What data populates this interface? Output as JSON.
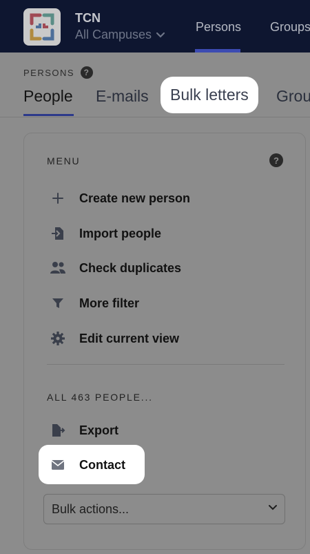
{
  "header": {
    "org": "TCN",
    "campus": "All Campuses",
    "nav": [
      "Persons",
      "Groups"
    ]
  },
  "subheader": {
    "section": "PERSONS",
    "tabs": [
      "People",
      "E-mails",
      "Bulk letters",
      "Grou"
    ]
  },
  "menu": {
    "title": "MENU",
    "items": [
      {
        "label": "Create new person",
        "icon": "plus-icon"
      },
      {
        "label": "Import people",
        "icon": "import-icon"
      },
      {
        "label": "Check duplicates",
        "icon": "people-icon"
      },
      {
        "label": "More filter",
        "icon": "filter-icon"
      },
      {
        "label": "Edit current view",
        "icon": "gear-icon"
      }
    ]
  },
  "all_people": {
    "title": "ALL 463 PEOPLE...",
    "items": [
      {
        "label": "Export",
        "icon": "export-icon"
      },
      {
        "label": "Contact",
        "icon": "envelope-icon"
      }
    ],
    "bulk_actions": "Bulk actions..."
  },
  "help_glyph": "?",
  "colors": {
    "topbar": "#0e1630",
    "accent": "#3c4bb2",
    "overlay_bg": "#8c8c8c",
    "highlight": "#ffffff"
  }
}
